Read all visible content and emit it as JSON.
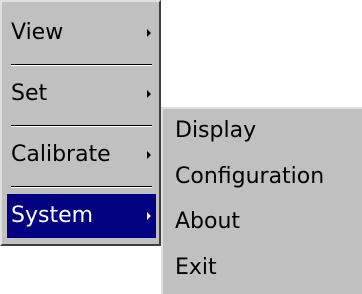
{
  "menu": {
    "items": [
      {
        "label": "View",
        "has_submenu": true,
        "selected": false
      },
      {
        "label": "Set",
        "has_submenu": true,
        "selected": false
      },
      {
        "label": "Calibrate",
        "has_submenu": true,
        "selected": false
      },
      {
        "label": "System",
        "has_submenu": true,
        "selected": true
      }
    ]
  },
  "submenu": {
    "parent": "System",
    "items": [
      {
        "label": "Display"
      },
      {
        "label": "Configuration"
      },
      {
        "label": "About"
      },
      {
        "label": "Exit"
      }
    ]
  },
  "colors": {
    "menu_background": "#c0c0c0",
    "selection_background": "#000080",
    "selection_text": "#ffffff",
    "text": "#000000"
  }
}
